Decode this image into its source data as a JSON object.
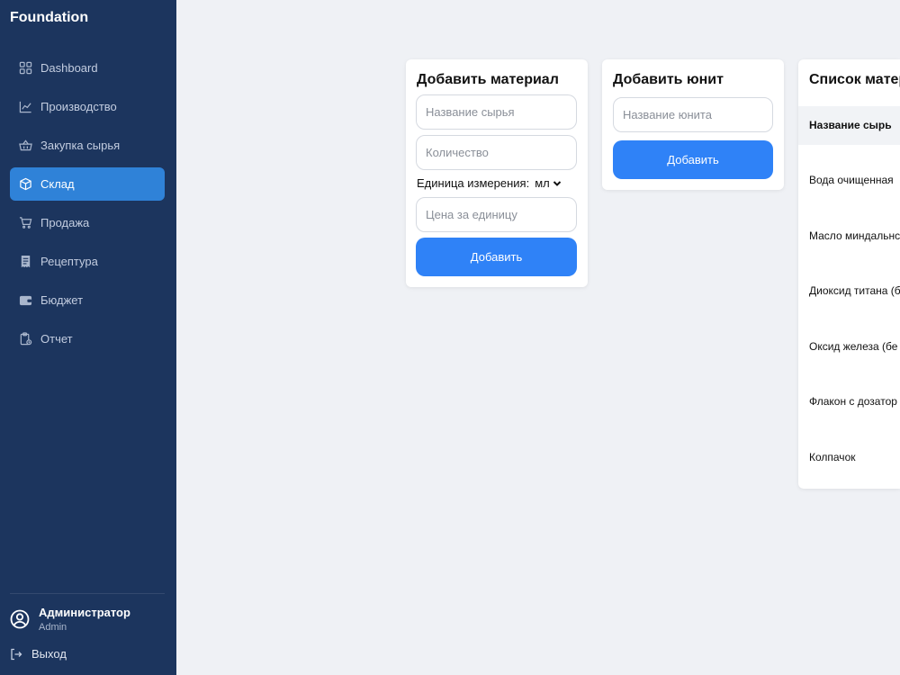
{
  "app": {
    "brand": "Foundation"
  },
  "sidebar": {
    "items": [
      {
        "label": "Dashboard",
        "icon": "dashboard-icon"
      },
      {
        "label": "Производство",
        "icon": "chart-icon"
      },
      {
        "label": "Закупка сырья",
        "icon": "basket-icon"
      },
      {
        "label": "Склад",
        "icon": "box-icon",
        "active": true
      },
      {
        "label": "Продажа",
        "icon": "cart-icon"
      },
      {
        "label": "Рецептура",
        "icon": "receipt-icon"
      },
      {
        "label": "Бюджет",
        "icon": "wallet-icon"
      },
      {
        "label": "Отчет",
        "icon": "clipboard-icon"
      }
    ],
    "user": {
      "name": "Администратор",
      "role": "Admin"
    },
    "logout_label": "Выход"
  },
  "add_material": {
    "title": "Добавить материал",
    "name_placeholder": "Название сырья",
    "quantity_placeholder": "Количество",
    "unit_label": "Единица измерения:",
    "unit_value": "мл",
    "price_placeholder": "Цена за единицу",
    "submit_label": "Добавить"
  },
  "add_unit": {
    "title": "Добавить юнит",
    "name_placeholder": "Название юнита",
    "submit_label": "Добавить"
  },
  "materials_list": {
    "title": "Список матер",
    "column_name": "Название сырь",
    "rows": [
      "Вода очищенная",
      "Масло миндальнс",
      "Диоксид титана (б",
      "Оксид железа (бе",
      "Флакон с дозатор",
      "Колпачок"
    ]
  },
  "colors": {
    "sidebar": "#1c355e",
    "active": "#2f82d8",
    "accent": "#2f82f7",
    "background": "#eff1f5"
  }
}
